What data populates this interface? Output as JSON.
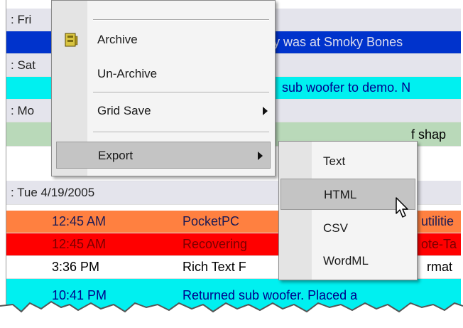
{
  "grid": {
    "rows": [
      {
        "kind": "hdr",
        "text": ": Fri"
      },
      {
        "kind": "blue",
        "time": "",
        "subject": "y was at Smoky Bones"
      },
      {
        "kind": "hdr",
        "text": ": Sat"
      },
      {
        "kind": "cyan",
        "time": "",
        "subject": "sub woofer to demo. N"
      },
      {
        "kind": "hdr",
        "text": ": Mo"
      },
      {
        "kind": "green",
        "time": "",
        "subject": "f shap"
      },
      {
        "kind": "hdr",
        "text": ": Tue 4/19/2005"
      },
      {
        "kind": "orange",
        "time": "12:45 AM",
        "subject": "PocketPC"
      },
      {
        "kind": "red",
        "time": "12:45 AM",
        "subject": "Recovering"
      },
      {
        "kind": "white",
        "time": "3:36 PM",
        "subject": "Rich Text F"
      },
      {
        "kind": "cyan",
        "time": "10:41 PM",
        "subject": "Returned sub woofer. Placed a"
      }
    ],
    "overflow_orange": "utilitie",
    "overflow_red": "ote-Ta",
    "overflow_white": "rmat"
  },
  "menu": {
    "items": [
      {
        "label": "Archive",
        "icon": "archive-icon"
      },
      {
        "label": "Un-Archive"
      },
      {
        "label": "Grid Save",
        "submenu": true
      },
      {
        "label": "Export",
        "submenu": true,
        "selected": true
      }
    ]
  },
  "submenu": {
    "items": [
      {
        "label": "Text"
      },
      {
        "label": "HTML",
        "selected": true
      },
      {
        "label": "CSV"
      },
      {
        "label": "WordML"
      }
    ]
  },
  "colors": {
    "blue_row": "#0033cc",
    "cyan_row": "#00f0f0",
    "orange_row": "#ff8040",
    "red_row": "#ff0000",
    "menu_highlight": "#c4c4c4"
  }
}
